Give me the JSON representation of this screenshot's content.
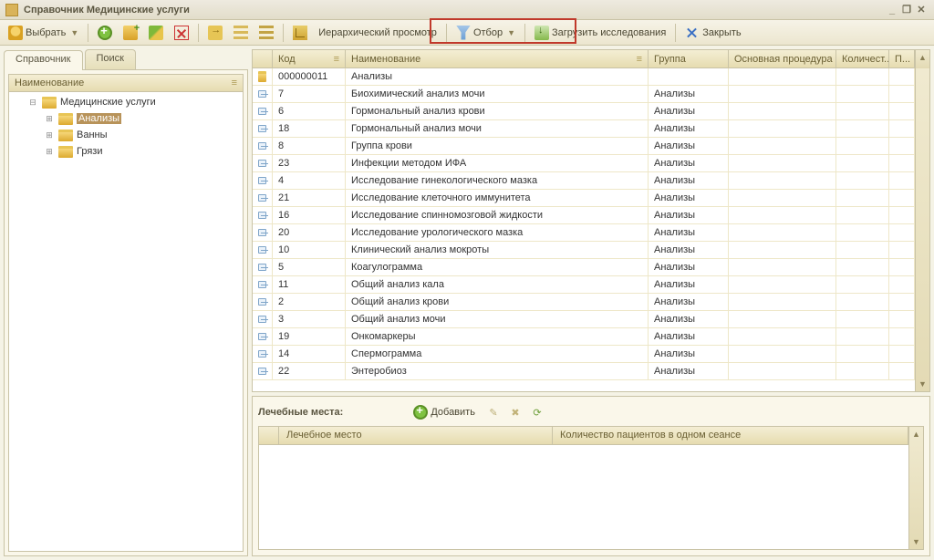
{
  "window": {
    "title": "Справочник Медицинские услуги"
  },
  "toolbar": {
    "select": "Выбрать",
    "hier_view": "Иерархический просмотр",
    "filter": "Отбор",
    "load": "Загрузить исследования",
    "close": "Закрыть"
  },
  "tabs": {
    "t1": "Справочник",
    "t2": "Поиск"
  },
  "tree": {
    "header": "Наименование",
    "root": "Медицинские услуги",
    "children": [
      "Анализы",
      "Ванны",
      "Грязи"
    ],
    "selected": "Анализы"
  },
  "grid": {
    "cols": {
      "code": "Код",
      "name": "Наименование",
      "group": "Группа",
      "proc": "Основная процедура",
      "qty": "Количест...",
      "p": "П..."
    },
    "rows": [
      {
        "folder": true,
        "code": "000000011",
        "name": "Анализы",
        "group": ""
      },
      {
        "folder": false,
        "code": "7",
        "name": "Биохимический анализ мочи",
        "group": "Анализы"
      },
      {
        "folder": false,
        "code": "6",
        "name": "Гормональный анализ крови",
        "group": "Анализы"
      },
      {
        "folder": false,
        "code": "18",
        "name": "Гормональный анализ мочи",
        "group": "Анализы"
      },
      {
        "folder": false,
        "code": "8",
        "name": "Группа крови",
        "group": "Анализы"
      },
      {
        "folder": false,
        "code": "23",
        "name": "Инфекции методом ИФА",
        "group": "Анализы"
      },
      {
        "folder": false,
        "code": "4",
        "name": "Исследование гинекологического мазка",
        "group": "Анализы"
      },
      {
        "folder": false,
        "code": "21",
        "name": "Исследование клеточного иммунитета",
        "group": "Анализы"
      },
      {
        "folder": false,
        "code": "16",
        "name": "Исследование спинномозговой жидкости",
        "group": "Анализы"
      },
      {
        "folder": false,
        "code": "20",
        "name": "Исследование урологического мазка",
        "group": "Анализы"
      },
      {
        "folder": false,
        "code": "10",
        "name": "Клинический анализ мокроты",
        "group": "Анализы"
      },
      {
        "folder": false,
        "code": "5",
        "name": "Коагулограмма",
        "group": "Анализы"
      },
      {
        "folder": false,
        "code": "11",
        "name": "Общий анализ кала",
        "group": "Анализы"
      },
      {
        "folder": false,
        "code": "2",
        "name": "Общий анализ крови",
        "group": "Анализы"
      },
      {
        "folder": false,
        "code": "3",
        "name": "Общий анализ мочи",
        "group": "Анализы"
      },
      {
        "folder": false,
        "code": "19",
        "name": "Онкомаркеры",
        "group": "Анализы"
      },
      {
        "folder": false,
        "code": "14",
        "name": "Спермограмма",
        "group": "Анализы"
      },
      {
        "folder": false,
        "code": "22",
        "name": "Энтеробиоз",
        "group": "Анализы"
      }
    ]
  },
  "bottom": {
    "title": "Лечебные места:",
    "add": "Добавить",
    "cols": {
      "place": "Лечебное место",
      "qty": "Количество пациентов в одном сеансе"
    }
  }
}
